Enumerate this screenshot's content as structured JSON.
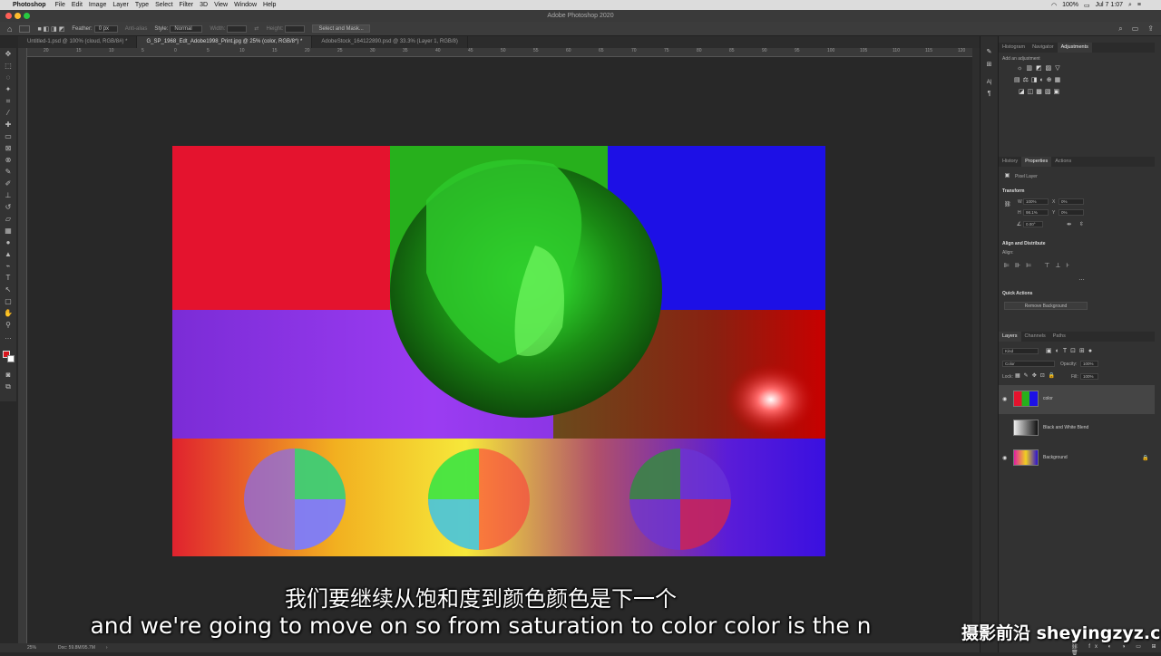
{
  "menubar": {
    "app": "Photoshop",
    "items": [
      "File",
      "Edit",
      "Image",
      "Layer",
      "Type",
      "Select",
      "Filter",
      "3D",
      "View",
      "Window",
      "Help"
    ],
    "battery": "100%",
    "clock": "Jul 7 1:07"
  },
  "window": {
    "title": "Adobe Photoshop 2020"
  },
  "options": {
    "feather_label": "Feather:",
    "feather_value": "0 px",
    "antialias_label": "Anti-alias",
    "style_label": "Style:",
    "style_value": "Normal",
    "width_label": "Width:",
    "height_label": "Height:",
    "select_mask_label": "Select and Mask..."
  },
  "tabs": [
    "Untitled-1.psd @ 100% (cloud, RGB/8#) *",
    "G_SP_1968_Edt_Adobe1998_Print.jpg @ 25% (color, RGB/8*) *",
    "AdobeStock_164122890.psd @ 33.3% (Layer 1, RGB/8)"
  ],
  "ruler_top": [
    "20",
    "15",
    "10",
    "5",
    "0",
    "5",
    "10",
    "15",
    "20",
    "25",
    "30",
    "35",
    "40",
    "45",
    "50",
    "55",
    "60",
    "65",
    "70",
    "75",
    "80",
    "85",
    "90",
    "95",
    "100",
    "105",
    "110",
    "115",
    "120"
  ],
  "status": {
    "zoom": "25%",
    "doc": "Doc: 59.8M/95.7M"
  },
  "panels": {
    "top_tabs": [
      "Histogram",
      "Navigator",
      "Adjustments"
    ],
    "adjust_hint": "Add an adjustment",
    "mid_tabs": [
      "History",
      "Properties",
      "Actions"
    ],
    "properties": {
      "kind": "Pixel Layer",
      "transform": "Transform",
      "w_label": "W",
      "w_value": "100%",
      "h_label": "H",
      "h_value": "98.1%",
      "x_label": "X",
      "x_value": "0%",
      "y_label": "Y",
      "y_value": "0%",
      "angle_value": "0.00°",
      "align_title": "Align and Distribute",
      "align_label": "Align:",
      "quick_title": "Quick Actions",
      "remove_bg": "Remove Background"
    },
    "layer_tabs": [
      "Layers",
      "Channels",
      "Paths"
    ],
    "kind_filter": "Kind",
    "blend_mode": "Color",
    "opacity_label": "Opacity:",
    "opacity_value": "100%",
    "lock_label": "Lock:",
    "fill_label": "Fill:",
    "fill_value": "100%",
    "layers": [
      {
        "name": "color",
        "visible": true
      },
      {
        "name": "Black and White Blend",
        "visible": false
      },
      {
        "name": "Background",
        "visible": true,
        "locked": true
      }
    ]
  },
  "subtitles": {
    "zh": "我们要继续从饱和度到颜色颜色是下一个",
    "en": "and we're going to move on so from saturation to color color is the n"
  },
  "watermark": "摄影前沿 sheyingzyz.com",
  "colors": {
    "accent": "#2d7bd6",
    "panel": "#323232",
    "canvas_bg": "#282828"
  }
}
